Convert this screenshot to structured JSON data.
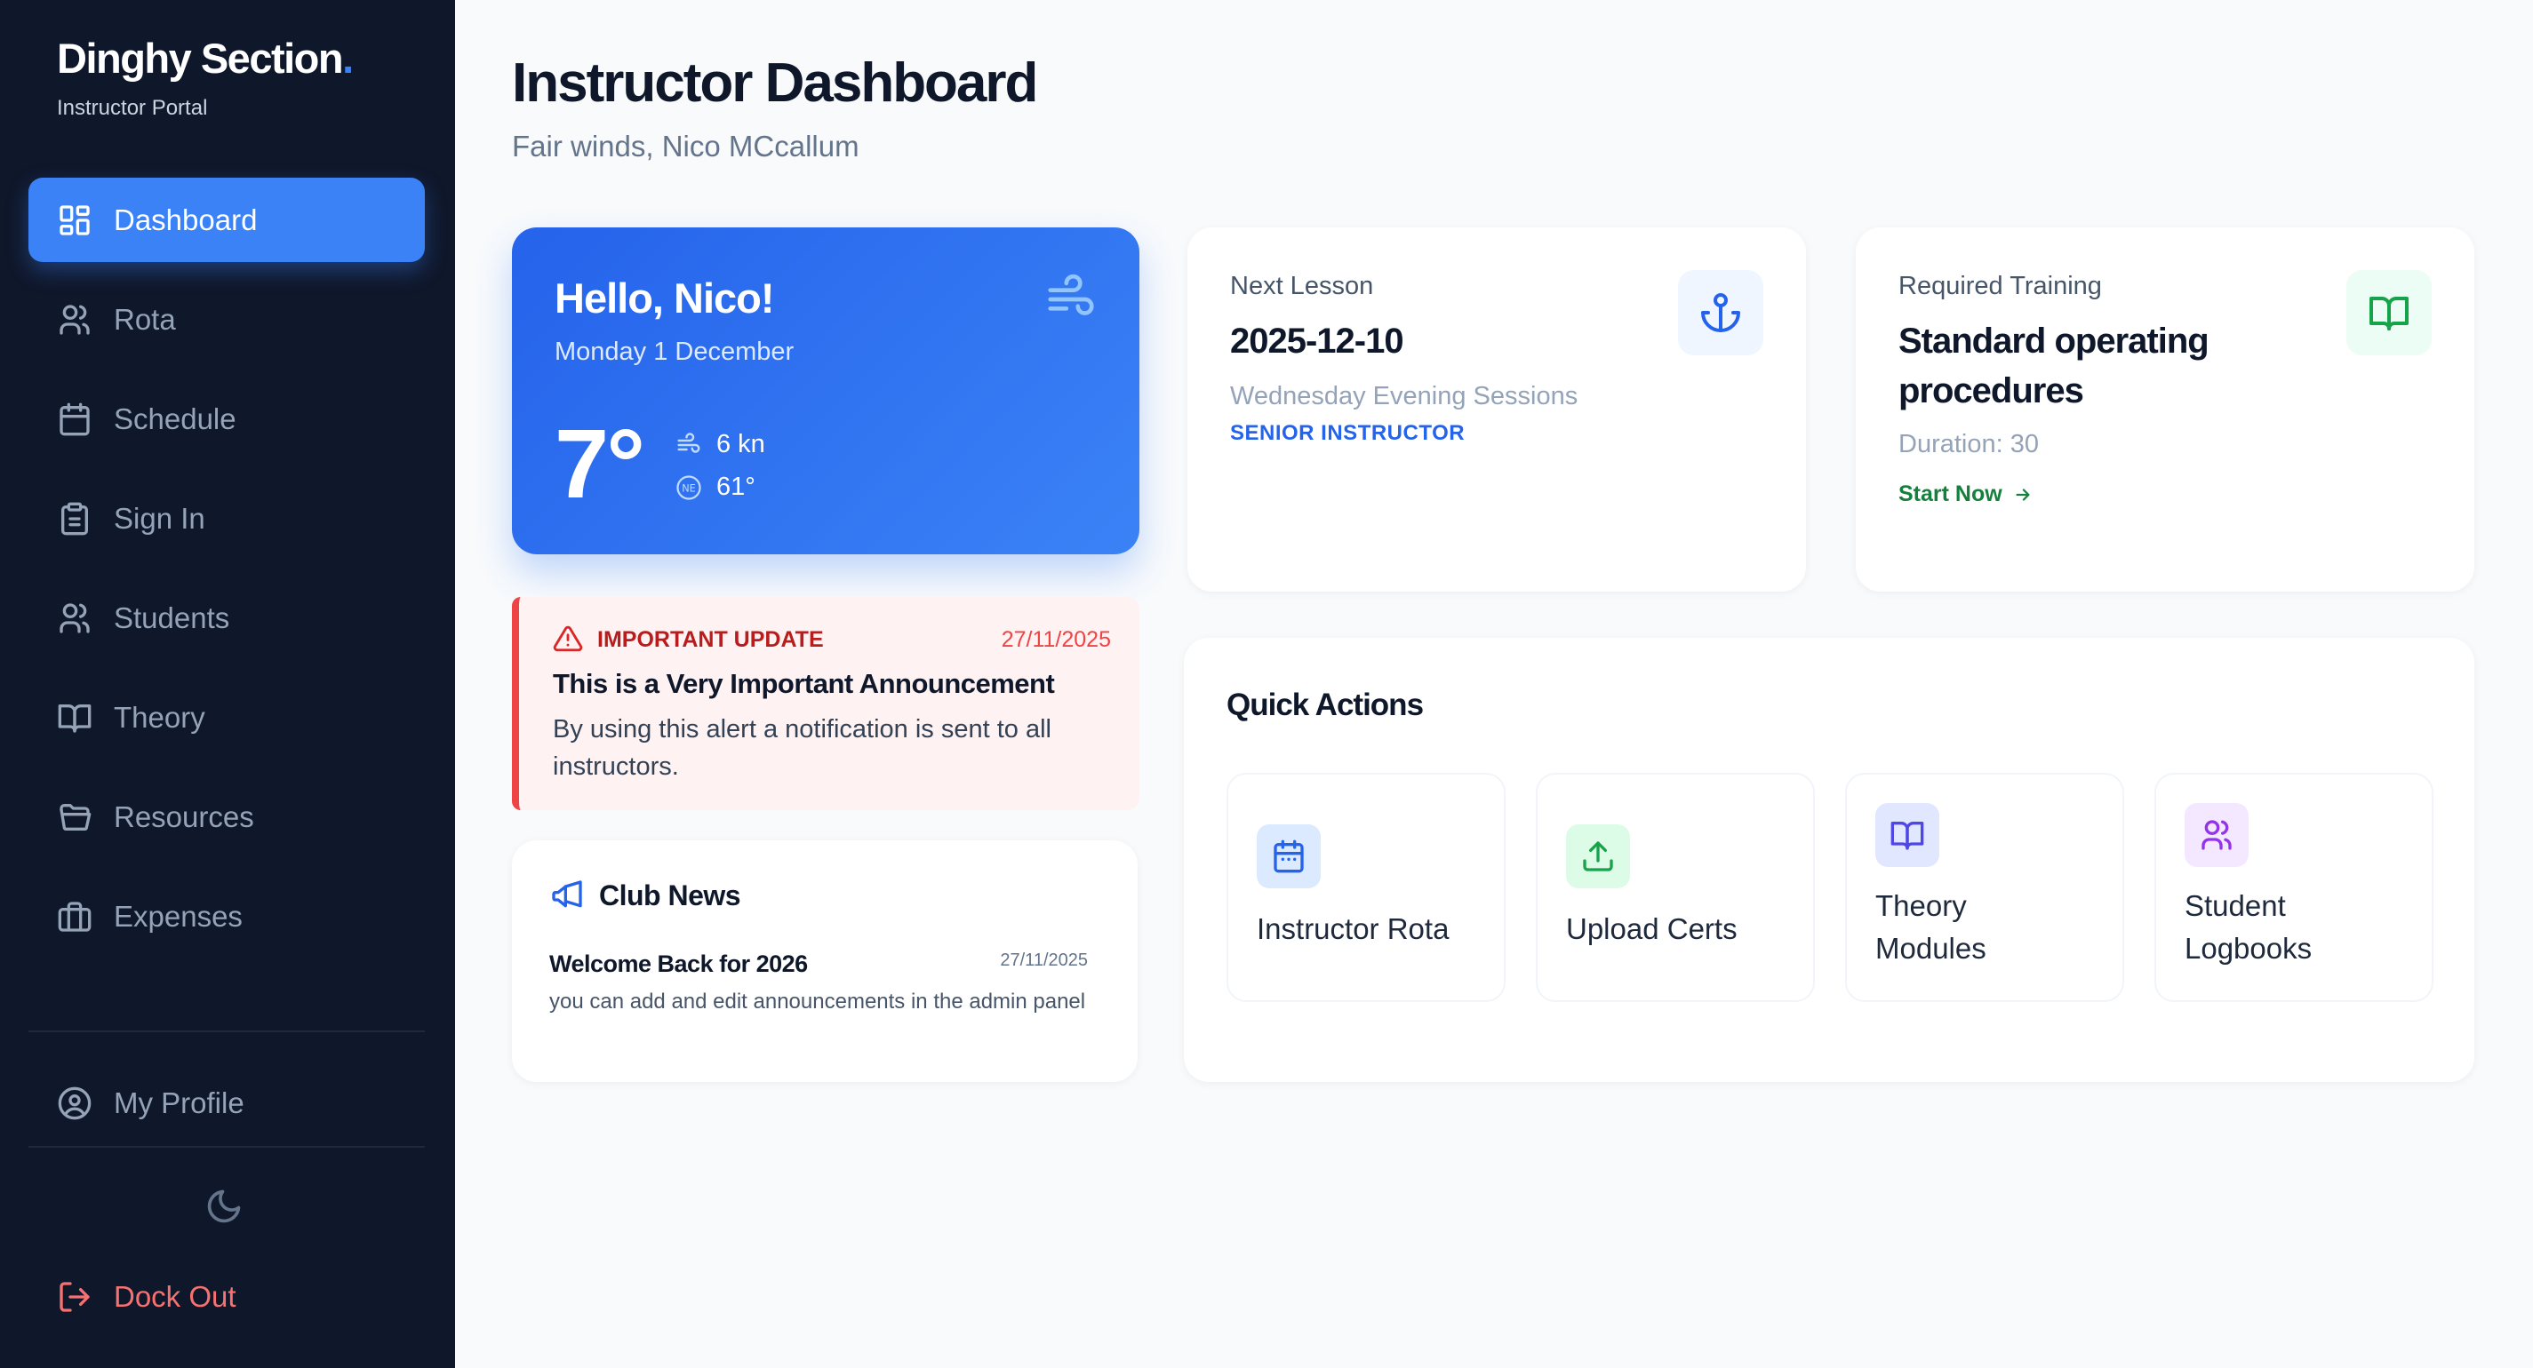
{
  "brand": {
    "name": "Dinghy Section",
    "dot": ".",
    "subtitle": "Instructor Portal"
  },
  "nav": {
    "items": [
      {
        "label": "Dashboard",
        "icon": "dashboard-icon",
        "active": true
      },
      {
        "label": "Rota",
        "icon": "users-icon"
      },
      {
        "label": "Schedule",
        "icon": "calendar-icon"
      },
      {
        "label": "Sign In",
        "icon": "clipboard-icon"
      },
      {
        "label": "Students",
        "icon": "users-icon"
      },
      {
        "label": "Theory",
        "icon": "book-icon"
      },
      {
        "label": "Resources",
        "icon": "folder-icon"
      },
      {
        "label": "Expenses",
        "icon": "briefcase-icon"
      }
    ],
    "profile": "My Profile",
    "logout": "Dock Out",
    "theme_icon": "moon-icon"
  },
  "header": {
    "title": "Instructor Dashboard",
    "greeting": "Fair winds, Nico MCcallum"
  },
  "weather": {
    "hello": "Hello, Nico!",
    "date": "Monday 1 December",
    "temperature": "7°",
    "wind_speed": "6 kn",
    "wind_direction": "61°",
    "direction_badge": "NE"
  },
  "alert": {
    "tag": "IMPORTANT UPDATE",
    "date": "27/11/2025",
    "title": "This is a Very Important Announcement",
    "body": "By using this alert a notification is sent to all instructors."
  },
  "news": {
    "heading": "Club News",
    "item_title": "Welcome Back for 2026",
    "item_date": "27/11/2025",
    "item_body": "you can add and edit announcements in the admin panel"
  },
  "lesson": {
    "label": "Next Lesson",
    "date": "2025-12-10",
    "session": "Wednesday Evening Sessions",
    "role": "SENIOR INSTRUCTOR",
    "icon": "anchor-icon"
  },
  "training": {
    "label": "Required Training",
    "title": "Standard operating procedures",
    "duration": "Duration: 30",
    "cta": "Start Now",
    "icon": "book-open-icon"
  },
  "quick_actions": {
    "heading": "Quick Actions",
    "tiles": [
      {
        "label": "Instructor Rota",
        "icon": "calendar-icon",
        "color": "#2563eb",
        "bg": "#dbeafe"
      },
      {
        "label": "Upload Certs",
        "icon": "upload-icon",
        "color": "#16a34a",
        "bg": "#dcfce7"
      },
      {
        "label": "Theory Modules",
        "icon": "book-open-icon",
        "color": "#4f46e5",
        "bg": "#e0e7ff"
      },
      {
        "label": "Student Logbooks",
        "icon": "users-icon",
        "color": "#9333ea",
        "bg": "#f3e8ff"
      }
    ]
  },
  "colors": {
    "sidebar": "#0f172a",
    "accent": "#3b82f6",
    "alert": "#ef4444",
    "success": "#15803d"
  }
}
